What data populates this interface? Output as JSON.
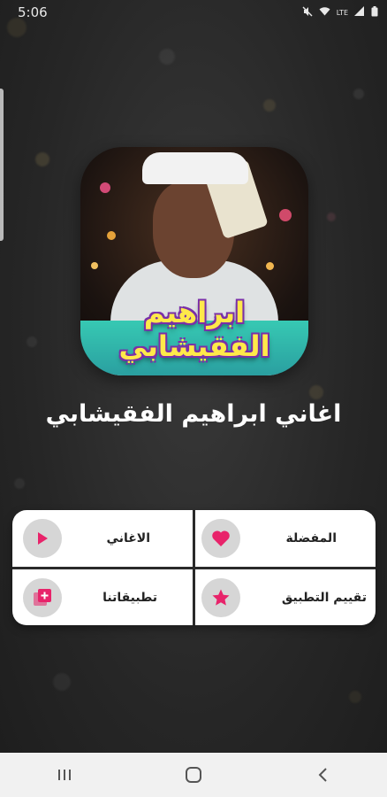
{
  "status_bar": {
    "time": "5:06",
    "icons": [
      "mute-icon",
      "wifi-icon",
      "lte-icon",
      "signal-icon",
      "battery-icon"
    ]
  },
  "artwork": {
    "title_text": "ابراهيم الفقيشابي"
  },
  "app_title": "اغاني ابراهيم الفقيشابي",
  "menu": {
    "favorites": {
      "label": "المفضلة",
      "icon": "heart-icon"
    },
    "songs": {
      "label": "الاغاني",
      "icon": "play-icon"
    },
    "rate_app": {
      "label": "تقييم التطبيق",
      "icon": "star-icon"
    },
    "our_apps": {
      "label": "تطبيقاتنا",
      "icon": "add-collection-icon"
    }
  },
  "nav_bar": {
    "buttons": [
      "recents-icon",
      "home-icon",
      "back-icon"
    ]
  },
  "colors": {
    "accent": "#e8236a",
    "card_background": "#ffffff",
    "icon_circle": "#d6d6d6",
    "page_background": "#2a2a2a"
  }
}
